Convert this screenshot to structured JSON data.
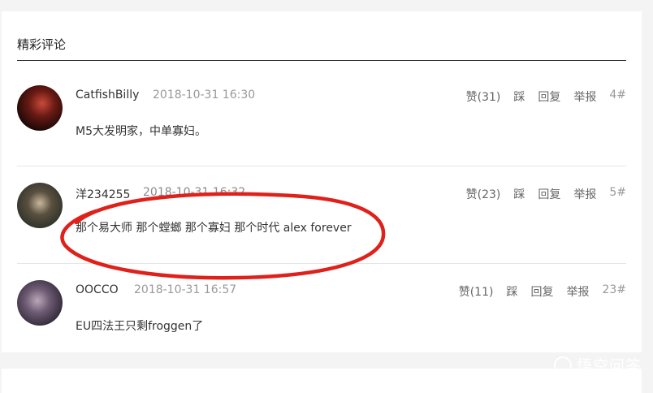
{
  "section": {
    "title": "精彩评论"
  },
  "comments": [
    {
      "username": "CatfishBilly",
      "time": "2018-10-31 16:30",
      "like": "赞(31)",
      "dislike": "踩",
      "reply": "回复",
      "report": "举报",
      "floor": "4#",
      "content": "M5大发明家，中单寡妇。"
    },
    {
      "username": "洋234255",
      "time": "2018-10-31 16:32",
      "like": "赞(23)",
      "dislike": "踩",
      "reply": "回复",
      "report": "举报",
      "floor": "5#",
      "content": "那个易大师 那个螳螂 那个寡妇 那个时代 alex forever"
    },
    {
      "username": "OOCCO",
      "time": "2018-10-31 16:57",
      "like": "赞(11)",
      "dislike": "踩",
      "reply": "回复",
      "report": "举报",
      "floor": "23#",
      "content": "EU四法王只剩froggen了"
    }
  ],
  "watermark": {
    "text": "悟空问答"
  },
  "colors": {
    "annotation": "#e0201a",
    "divider": "#e6e6e6"
  }
}
